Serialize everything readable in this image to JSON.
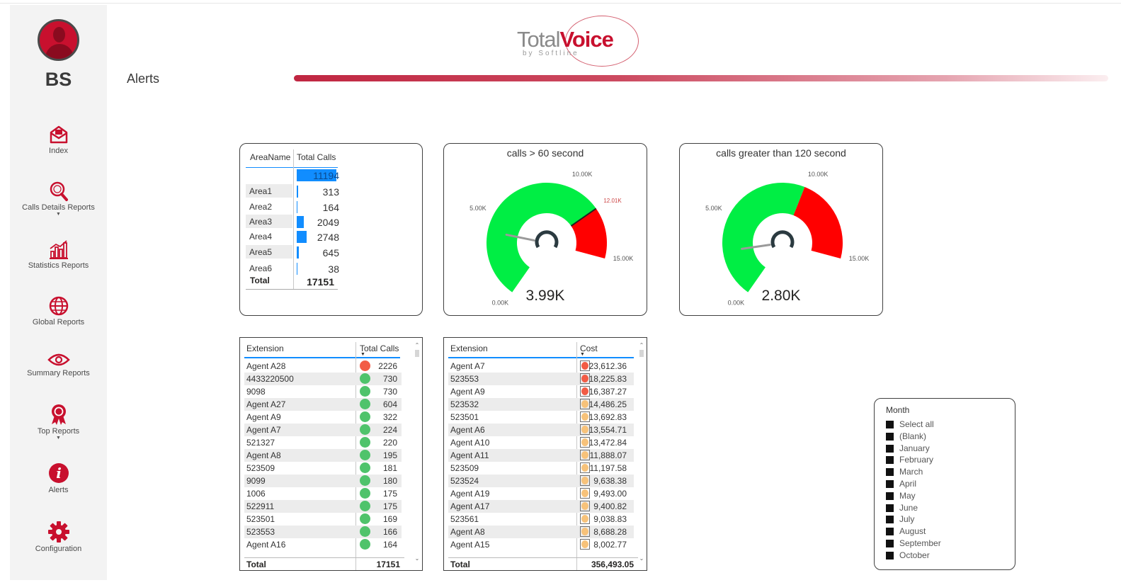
{
  "user": {
    "initials": "BS"
  },
  "nav": [
    {
      "label": "Index",
      "icon": "inbox-icon"
    },
    {
      "label": "Calls Details Reports",
      "icon": "search-icon",
      "caret": "▼"
    },
    {
      "label": "Statistics Reports",
      "icon": "bar-chart-icon"
    },
    {
      "label": "Global Reports",
      "icon": "globe-icon"
    },
    {
      "label": "Summary Reports",
      "icon": "eye-icon"
    },
    {
      "label": "Top Reports",
      "icon": "award-icon",
      "caret": "▼"
    },
    {
      "label": "Alerts",
      "icon": "alert-icon"
    },
    {
      "label": "Configuration",
      "icon": "gear-icon"
    }
  ],
  "header": {
    "logo_part1": "Total",
    "logo_part2": "Voice",
    "logo_sub": "by Softline",
    "page_title": "Alerts"
  },
  "colors": {
    "brand": "#c8102e",
    "accent_blue": "#118dff",
    "gauge_green": "#00ee44",
    "gauge_red": "#ff0000",
    "dot_green": "#4fc36b",
    "dot_red": "#f25c45",
    "dot_orange": "#f7c27a"
  },
  "area_table": {
    "col1": "AreaName",
    "col2": "Total Calls",
    "rows": [
      {
        "name": "",
        "value": "11194",
        "fraction": 1.0
      },
      {
        "name": "Area1",
        "value": "313",
        "fraction": 0.03
      },
      {
        "name": "Area2",
        "value": "164",
        "fraction": 0.015
      },
      {
        "name": "Area3",
        "value": "2049",
        "fraction": 0.18
      },
      {
        "name": "Area4",
        "value": "2748",
        "fraction": 0.245
      },
      {
        "name": "Area5",
        "value": "645",
        "fraction": 0.058
      },
      {
        "name": "Area6",
        "value": "38",
        "fraction": 0.004
      }
    ],
    "total_label": "Total",
    "total_value": "17151"
  },
  "gauges": [
    {
      "title": "calls > 60 second",
      "value_label": "3.99K",
      "value": 3990,
      "max": 15000,
      "green_until": 12010,
      "target": 12010,
      "labels": {
        "min": "0.00K",
        "q1": "5.00K",
        "q2": "10.00K",
        "target": "12.01K",
        "max": "15.00K"
      }
    },
    {
      "title": "calls greater than 120 second",
      "value_label": "2.80K",
      "value": 2800,
      "max": 15000,
      "green_until": 10000,
      "labels": {
        "min": "0.00K",
        "q1": "5.00K",
        "q2": "10.00K",
        "max": "15.00K"
      }
    }
  ],
  "calls_table": {
    "col1": "Extension",
    "col2": "Total Calls",
    "sort_icon": "▼",
    "rows": [
      {
        "ext": "Agent A28",
        "value": "2226",
        "status": "red"
      },
      {
        "ext": "4433220500",
        "value": "730",
        "status": "green"
      },
      {
        "ext": "9098",
        "value": "730",
        "status": "green"
      },
      {
        "ext": "Agent A27",
        "value": "604",
        "status": "green"
      },
      {
        "ext": "Agent A9",
        "value": "322",
        "status": "green"
      },
      {
        "ext": "Agent A7",
        "value": "224",
        "status": "green"
      },
      {
        "ext": "521327",
        "value": "220",
        "status": "green"
      },
      {
        "ext": "Agent A8",
        "value": "195",
        "status": "green"
      },
      {
        "ext": "523509",
        "value": "181",
        "status": "green"
      },
      {
        "ext": "9099",
        "value": "180",
        "status": "green"
      },
      {
        "ext": "1006",
        "value": "175",
        "status": "green"
      },
      {
        "ext": "522911",
        "value": "175",
        "status": "green"
      },
      {
        "ext": "523501",
        "value": "169",
        "status": "green"
      },
      {
        "ext": "523553",
        "value": "166",
        "status": "green"
      },
      {
        "ext": "Agent A16",
        "value": "164",
        "status": "green"
      }
    ],
    "total_label": "Total",
    "total_value": "17151"
  },
  "cost_table": {
    "col1": "Extension",
    "col2": "Cost",
    "sort_icon": "▼",
    "rows": [
      {
        "ext": "Agent A7",
        "value": "23,612.36",
        "status": "red"
      },
      {
        "ext": "523553",
        "value": "18,225.83",
        "status": "red"
      },
      {
        "ext": "Agent A9",
        "value": "16,387.27",
        "status": "red"
      },
      {
        "ext": "523532",
        "value": "14,486.25",
        "status": "orange"
      },
      {
        "ext": "523501",
        "value": "13,692.83",
        "status": "orange"
      },
      {
        "ext": "Agent A6",
        "value": "13,554.71",
        "status": "orange"
      },
      {
        "ext": "Agent A10",
        "value": "13,472.84",
        "status": "orange"
      },
      {
        "ext": "Agent A11",
        "value": "11,888.07",
        "status": "orange"
      },
      {
        "ext": "523509",
        "value": "11,197.58",
        "status": "orange"
      },
      {
        "ext": "523524",
        "value": "9,638.38",
        "status": "orange"
      },
      {
        "ext": "Agent A19",
        "value": "9,493.00",
        "status": "orange"
      },
      {
        "ext": "Agent A17",
        "value": "9,400.82",
        "status": "orange"
      },
      {
        "ext": "523561",
        "value": "9,038.83",
        "status": "orange"
      },
      {
        "ext": "Agent A8",
        "value": "8,688.28",
        "status": "orange"
      },
      {
        "ext": "Agent A15",
        "value": "8,002.77",
        "status": "orange"
      }
    ],
    "total_label": "Total",
    "total_value": "356,493.05"
  },
  "month_slicer": {
    "title": "Month",
    "options": [
      "Select all",
      "(Blank)",
      "January",
      "February",
      "March",
      "April",
      "May",
      "June",
      "July",
      "August",
      "September",
      "October"
    ]
  }
}
